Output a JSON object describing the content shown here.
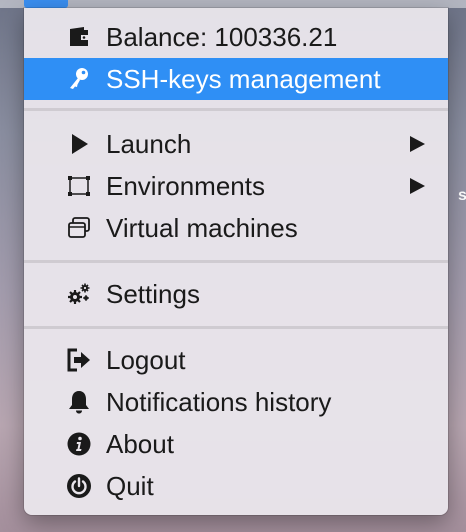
{
  "menu": {
    "balance": {
      "label": "Balance: 100336.21",
      "icon": "wallet-icon"
    },
    "ssh_keys": {
      "label": "SSH-keys management",
      "icon": "key-icon",
      "highlighted": true
    },
    "launch": {
      "label": "Launch",
      "icon": "play-icon",
      "submenu": true
    },
    "environments": {
      "label": "Environments",
      "icon": "selection-box-icon",
      "submenu": true
    },
    "virtual_machines": {
      "label": "Virtual machines",
      "icon": "windows-icon"
    },
    "settings": {
      "label": "Settings",
      "icon": "gears-icon"
    },
    "logout": {
      "label": "Logout",
      "icon": "logout-icon"
    },
    "notifications_history": {
      "label": "Notifications history",
      "icon": "bell-icon"
    },
    "about": {
      "label": "About",
      "icon": "info-icon"
    },
    "quit": {
      "label": "Quit",
      "icon": "power-icon"
    }
  },
  "colors": {
    "highlight": "#2f8ff5",
    "menu_background": "#e9e5eb",
    "text": "#1a1a1a"
  }
}
